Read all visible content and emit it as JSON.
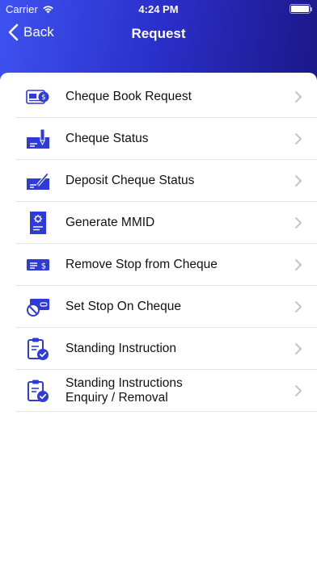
{
  "status_bar": {
    "carrier": "Carrier",
    "time": "4:24 PM"
  },
  "nav": {
    "back_label": "Back",
    "title": "Request"
  },
  "colors": {
    "accent": "#2e3bd6",
    "header_start": "#3f52f0",
    "header_end": "#160f6d"
  },
  "menu": [
    {
      "label": "Cheque Book Request",
      "icon": "cheque-book-icon"
    },
    {
      "label": "Cheque Status",
      "icon": "cheque-status-icon"
    },
    {
      "label": "Deposit Cheque Status",
      "icon": "deposit-cheque-icon"
    },
    {
      "label": "Generate MMID",
      "icon": "mmid-document-icon"
    },
    {
      "label": "Remove Stop from Cheque",
      "icon": "remove-stop-cheque-icon"
    },
    {
      "label": "Set Stop On Cheque",
      "icon": "stop-cheque-icon"
    },
    {
      "label": "Standing Instruction",
      "icon": "clipboard-check-icon"
    },
    {
      "label": "Standing Instructions\nEnquiry / Removal",
      "icon": "clipboard-check-icon"
    }
  ]
}
